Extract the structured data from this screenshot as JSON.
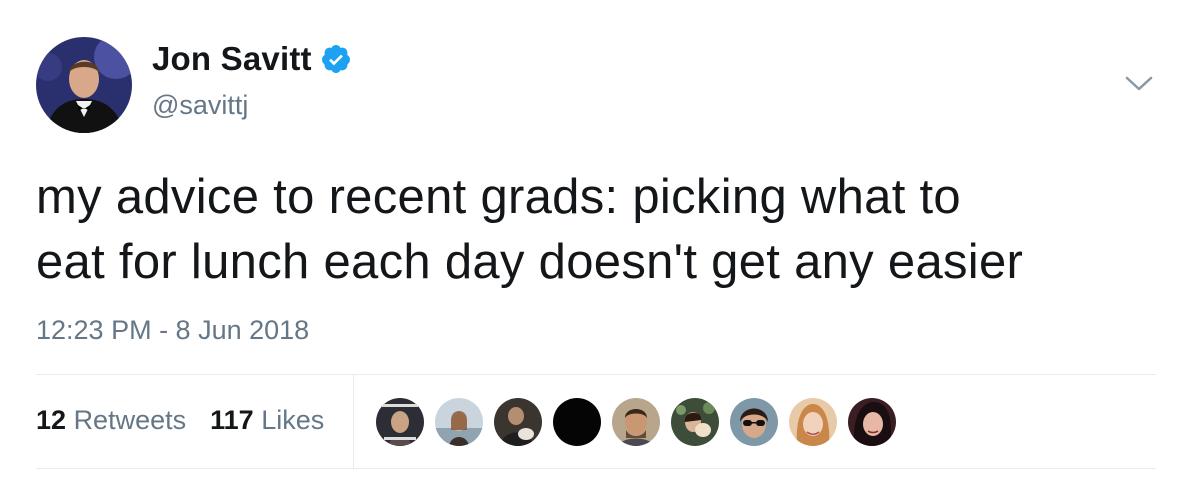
{
  "author": {
    "display_name": "Jon Savitt",
    "handle": "@savittj",
    "verified": true,
    "avatar_icon": "profile-photo"
  },
  "tweet": {
    "text_line1": "my advice to recent grads: picking what to",
    "text_line2": "eat for lunch each day doesn't get any easier",
    "timestamp": "12:23 PM - 8 Jun 2018"
  },
  "stats": {
    "retweets_count": "12",
    "retweets_label": "Retweets",
    "likes_count": "117",
    "likes_label": "Likes"
  },
  "likers": [
    {
      "icon": "liker-avatar"
    },
    {
      "icon": "liker-avatar"
    },
    {
      "icon": "liker-avatar"
    },
    {
      "icon": "liker-avatar"
    },
    {
      "icon": "liker-avatar"
    },
    {
      "icon": "liker-avatar"
    },
    {
      "icon": "liker-avatar"
    },
    {
      "icon": "liker-avatar"
    },
    {
      "icon": "liker-avatar"
    }
  ],
  "colors": {
    "text": "#14171a",
    "secondary": "#657786",
    "verified_blue": "#1da1f2",
    "divider": "#e6ecf0"
  }
}
